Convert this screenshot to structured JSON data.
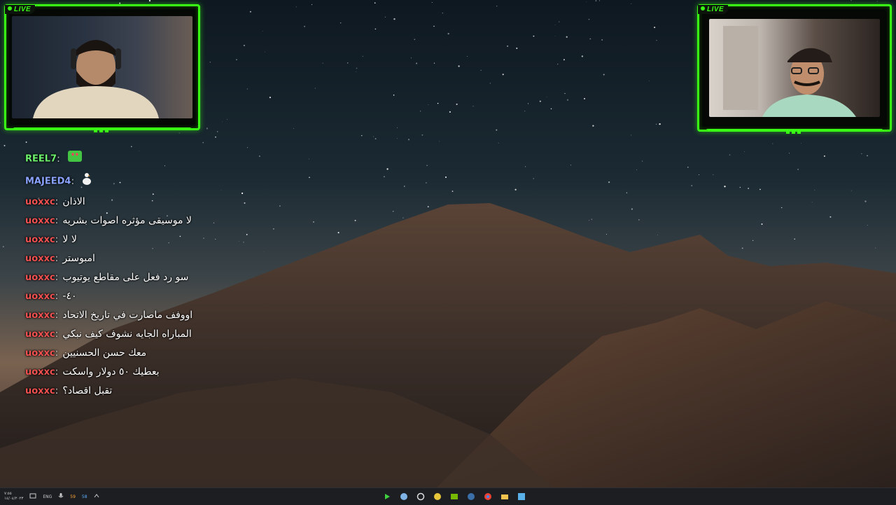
{
  "overlay": {
    "live_label": "LIVE",
    "accent_color": "#39ff14"
  },
  "chat": {
    "messages": [
      {
        "user": "REEL7",
        "user_color": "#6cf06c",
        "text": "",
        "emote": "heart-eyes-emote"
      },
      {
        "user": "MAJEED4",
        "user_color": "#8aa2ff",
        "text": "",
        "emote": "goose-emote"
      },
      {
        "user": "uoxxc",
        "user_color": "#f05050",
        "text": "الاذان"
      },
      {
        "user": "uoxxc",
        "user_color": "#f05050",
        "text": "لا موسيقى مؤثره اصوات بشريه"
      },
      {
        "user": "uoxxc",
        "user_color": "#f05050",
        "text": "لا لا"
      },
      {
        "user": "uoxxc",
        "user_color": "#f05050",
        "text": "امبوستر"
      },
      {
        "user": "uoxxc",
        "user_color": "#f05050",
        "text": "سو رد فعل على مقاطع يوتيوب"
      },
      {
        "user": "uoxxc",
        "user_color": "#f05050",
        "text": "٤٠-"
      },
      {
        "user": "uoxxc",
        "user_color": "#f05050",
        "text": "اووفف ماصارت في تاريخ الاتحاد"
      },
      {
        "user": "uoxxc",
        "user_color": "#f05050",
        "text": "المباراه الجايه نشوف كيف نبكي"
      },
      {
        "user": "uoxxc",
        "user_color": "#f05050",
        "text": "معك حسن الحسنيين"
      },
      {
        "user": "uoxxc",
        "user_color": "#f05050",
        "text": "بعطيك ٥٠ دولار واسكت"
      },
      {
        "user": "uoxxc",
        "user_color": "#f05050",
        "text": "تقبل اقصاد؟"
      }
    ]
  },
  "taskbar": {
    "clock_time": "٧:٥٥",
    "clock_date": "١٤/٠٤/٢٠٢٣",
    "language": "ENG",
    "tray_value_1": "59",
    "tray_value_2": "58",
    "apps": [
      "play-icon",
      "steam-icon",
      "settings-wheel-icon",
      "yellow-app-icon",
      "nvidia-icon",
      "steam-icon",
      "chrome-icon",
      "folder-icon",
      "window-icon"
    ]
  }
}
